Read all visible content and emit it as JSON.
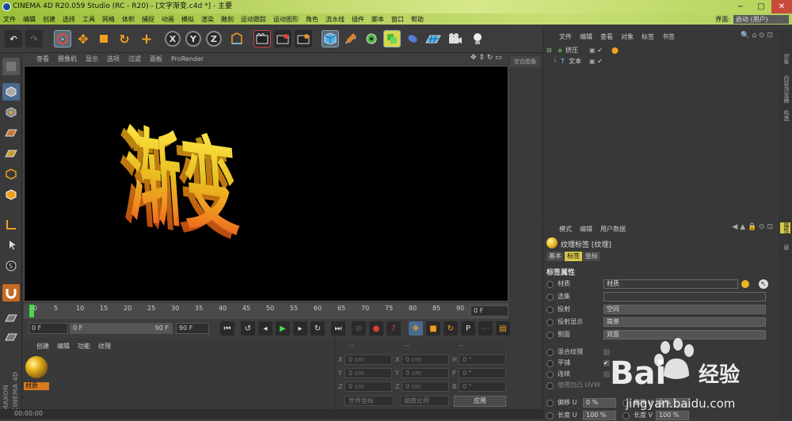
{
  "title_bar": {
    "title": "CINEMA 4D R20.059 Studio (RC - R20) - [文字渐变.c4d *] - 主要",
    "window_controls": [
      "−",
      "□",
      "✕"
    ]
  },
  "menu": {
    "items": [
      "文件",
      "编辑",
      "创建",
      "选择",
      "工具",
      "网格",
      "体积",
      "捕捉",
      "动画",
      "模拟",
      "渲染",
      "雕刻",
      "运动跟踪",
      "运动图形",
      "角色",
      "流水线",
      "插件",
      "脚本",
      "窗口",
      "帮助"
    ],
    "layout_label": "界面:",
    "layout_value": "启动 (用户)"
  },
  "viewport": {
    "menu": [
      "查看",
      "摄像机",
      "显示",
      "选项",
      "过滤",
      "面板",
      "ProRender"
    ],
    "side_button": "空白图像",
    "text": "渐变",
    "colors": {
      "top": "#e8c020",
      "mid": "#f0a020",
      "bottom": "#e85020"
    }
  },
  "timeline": {
    "ticks": [
      "0",
      "5",
      "10",
      "15",
      "20",
      "25",
      "30",
      "35",
      "40",
      "45",
      "50",
      "55",
      "60",
      "65",
      "70",
      "75",
      "80",
      "85",
      "90"
    ],
    "frame": "0 F"
  },
  "transport": {
    "start": "0 F",
    "range_start": "0 F",
    "range_end": "90 F",
    "end": "90 F"
  },
  "material_panel": {
    "menu": [
      "创建",
      "编辑",
      "功能",
      "纹理"
    ],
    "material_name": "材质",
    "brand_line1": "MAXON",
    "brand_line2": "CINEMA 4D"
  },
  "coordinates": {
    "headers": [
      "--",
      "--",
      "--"
    ],
    "rows": [
      {
        "a": "X",
        "av": "0 cm",
        "b": "X",
        "bv": "0 cm",
        "c": "H",
        "cv": "0 °"
      },
      {
        "a": "Y",
        "av": "0 cm",
        "b": "Y",
        "bv": "0 cm",
        "c": "P",
        "cv": "0 °"
      },
      {
        "a": "Z",
        "av": "0 cm",
        "b": "Z",
        "bv": "0 cm",
        "c": "B",
        "cv": "0 °"
      }
    ],
    "mode1": "世界坐标",
    "mode2": "缩放比例",
    "apply": "应用"
  },
  "status": {
    "time": "00:00:00"
  },
  "objects": {
    "menu": [
      "文件",
      "编辑",
      "查看",
      "对象",
      "标签",
      "书签"
    ],
    "items": [
      {
        "name": "挤压",
        "indent": 0
      },
      {
        "name": "文本",
        "indent": 1
      }
    ]
  },
  "attributes": {
    "menu": [
      "模式",
      "编辑",
      "用户数据"
    ],
    "header": "纹理标签 [纹理]",
    "tabs": [
      "基本",
      "标签",
      "坐标"
    ],
    "section": "标签属性",
    "rows": [
      {
        "label": "材质",
        "value": "材质"
      },
      {
        "label": "选集",
        "value": ""
      },
      {
        "label": "投射",
        "value": "空间"
      },
      {
        "label": "投射显示",
        "value": "简单"
      },
      {
        "label": "侧面",
        "value": "双面"
      }
    ],
    "checks": [
      {
        "label": "混合纹理"
      },
      {
        "label": "平铺"
      },
      {
        "label": "连续"
      },
      {
        "label": "使用凹凸 UVW"
      }
    ],
    "offset_u_label": "偏移 U",
    "offset_u": "0 %",
    "offset_v_label": "偏移 V",
    "offset_v": "0 %",
    "length_u_label": "长度 U",
    "length_u": "100 %",
    "length_v_label": "长度 V",
    "length_v": "100 %"
  },
  "right_tabs": [
    "对象",
    "内容浏览器",
    "构造",
    "属性",
    "层"
  ],
  "watermark": {
    "brand": "Bai",
    "brand2": "经验",
    "url": "jingyan.baidu.com"
  }
}
